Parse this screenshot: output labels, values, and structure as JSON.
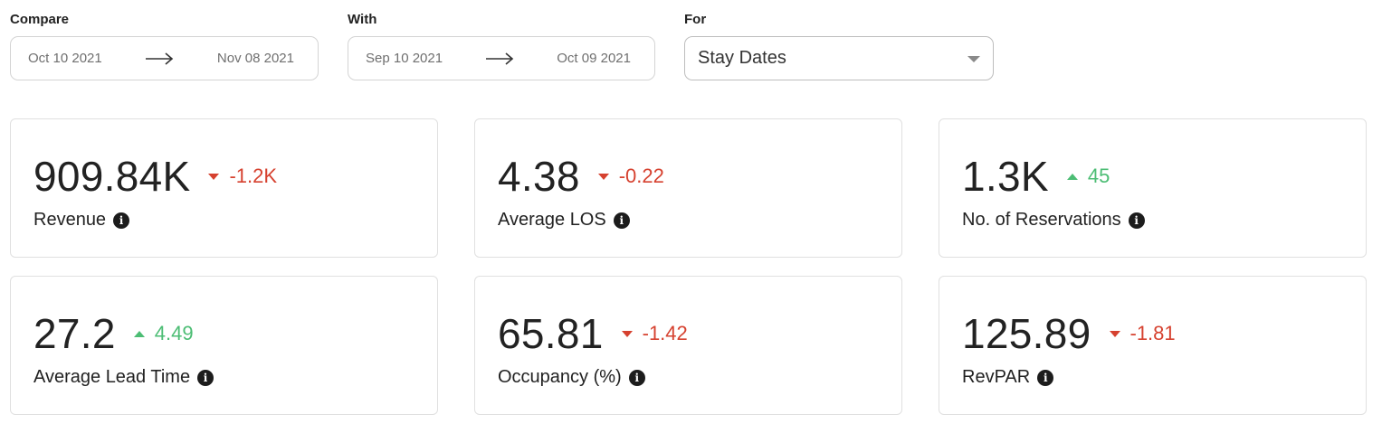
{
  "filters": {
    "compare": {
      "label": "Compare",
      "start": "Oct 10 2021",
      "end": "Nov 08 2021"
    },
    "with": {
      "label": "With",
      "start": "Sep 10 2021",
      "end": "Oct 09 2021"
    },
    "for": {
      "label": "For",
      "selected": "Stay Dates"
    }
  },
  "colors": {
    "down": "#d6412f",
    "up": "#4cbd74"
  },
  "metrics": [
    {
      "value": "909.84K",
      "delta": "-1.2K",
      "direction": "down",
      "label": "Revenue"
    },
    {
      "value": "4.38",
      "delta": "-0.22",
      "direction": "down",
      "label": "Average LOS"
    },
    {
      "value": "1.3K",
      "delta": "45",
      "direction": "up",
      "label": "No. of Reservations"
    },
    {
      "value": "27.2",
      "delta": "4.49",
      "direction": "up",
      "label": "Average Lead Time"
    },
    {
      "value": "65.81",
      "delta": "-1.42",
      "direction": "down",
      "label": "Occupancy (%)"
    },
    {
      "value": "125.89",
      "delta": "-1.81",
      "direction": "down",
      "label": "RevPAR"
    }
  ],
  "icons": {
    "info": "info-icon",
    "arrow": "arrow-right-icon",
    "caret": "caret-down-icon"
  }
}
